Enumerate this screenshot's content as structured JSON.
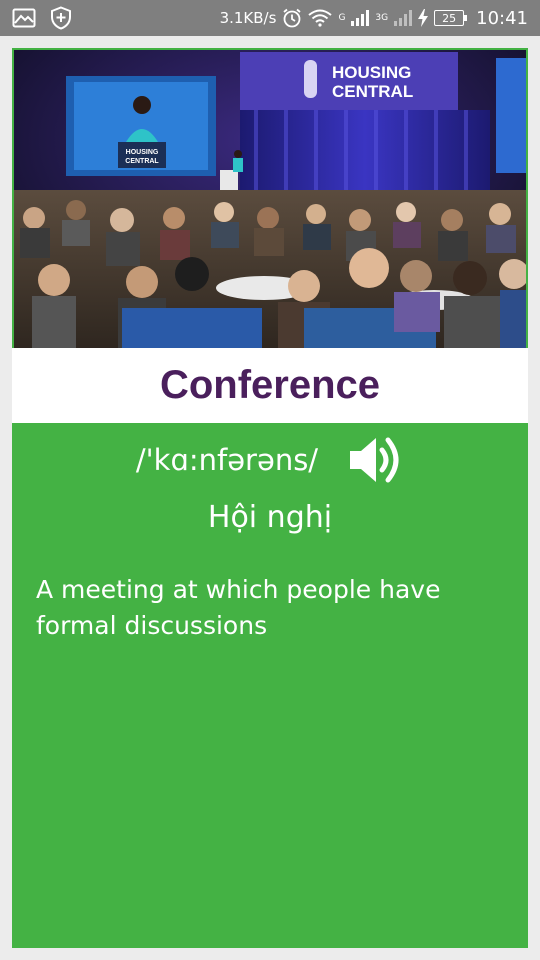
{
  "status_bar": {
    "icons": [
      "image-icon",
      "shield-icon",
      "alarm-icon",
      "wifi-icon",
      "signal-icon",
      "charging-icon"
    ],
    "network_speed": "3.1KB/s",
    "network_type_1": "G",
    "network_type_2": "3G",
    "battery_level": "25",
    "time": "10:41"
  },
  "card": {
    "background_color": "#44b244",
    "image": {
      "screen_text_1": "HOUSING",
      "screen_text_2": "CENTRAL",
      "podium_text_1": "HOUSING",
      "podium_text_2": "CENTRAL"
    },
    "word": "Conference",
    "word_color": "#4a1f5c",
    "phonetic": "/'kɑ:nfərəns/",
    "speaker_icon": "speaker-icon",
    "meaning": "Hội nghị",
    "definition": "A meeting at which people have formal discussions"
  }
}
